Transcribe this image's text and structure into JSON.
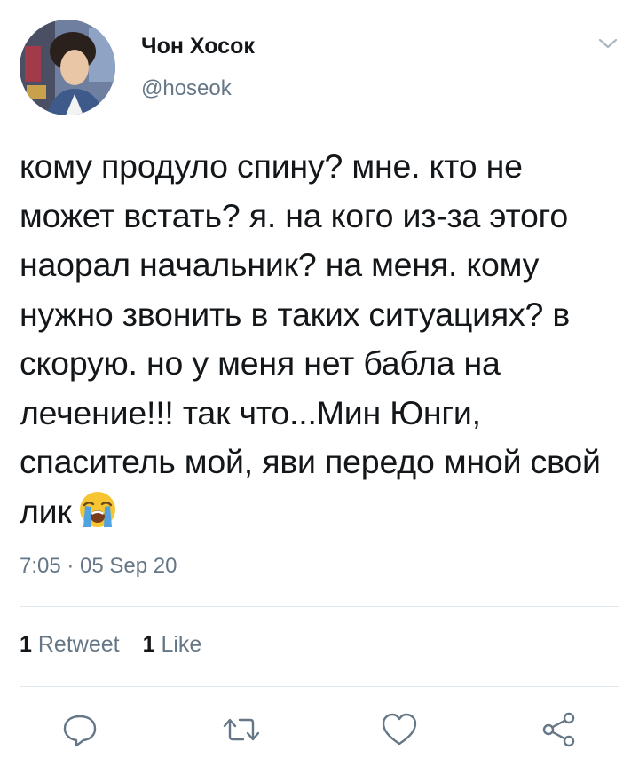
{
  "author": {
    "display_name": "Чон Хосок",
    "handle": "@hoseok"
  },
  "tweet": {
    "text": "кому продуло спину? мне. кто не может встать? я. на кого из-за этого наорал начальник? на меня. кому нужно звонить в таких ситуациях? в скорую. но у меня нет бабла на лечение!!! так что...Мин Юнги, спаситель мой, яви передо мной свой лик",
    "emoji": "loudly-crying-face",
    "timestamp": "7:05 · 05 Sep 20"
  },
  "stats": {
    "retweets_count": "1",
    "retweets_label": "Retweet",
    "likes_count": "1",
    "likes_label": "Like"
  },
  "actions": [
    "reply-icon",
    "retweet-icon",
    "like-icon",
    "share-icon"
  ],
  "colors": {
    "text": "#14171a",
    "secondary": "#657786",
    "divider": "#e1e8ed"
  }
}
